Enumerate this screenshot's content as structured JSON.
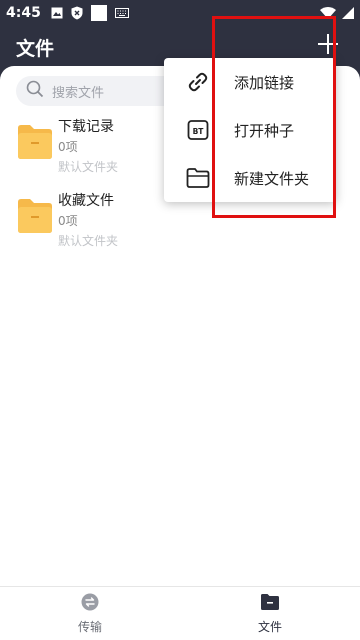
{
  "status_bar": {
    "time": "4:45",
    "icons": [
      "image-icon",
      "shield-icon",
      "square-icon",
      "keyboard-icon"
    ],
    "right_icons": [
      "wifi-icon",
      "signal-icon"
    ]
  },
  "header": {
    "title": "文件",
    "add_icon": "plus-icon"
  },
  "search": {
    "placeholder": "搜索文件"
  },
  "folders": [
    {
      "name": "下载记录",
      "count": "0项",
      "desc": "默认文件夹"
    },
    {
      "name": "收藏文件",
      "count": "0项",
      "desc": "默认文件夹"
    }
  ],
  "menu": {
    "items": [
      {
        "label": "添加链接",
        "icon": "link-icon"
      },
      {
        "label": "打开种子",
        "icon": "bt-icon"
      },
      {
        "label": "新建文件夹",
        "icon": "folder-outline-icon"
      }
    ]
  },
  "bottom_nav": {
    "tabs": [
      {
        "label": "传输",
        "icon": "transfer-icon",
        "active": false
      },
      {
        "label": "文件",
        "icon": "folder-filled-icon",
        "active": true
      }
    ]
  },
  "colors": {
    "header_bg": "#2e3140",
    "folder_yellow": "#f6b94a",
    "highlight_red": "#e01010"
  }
}
